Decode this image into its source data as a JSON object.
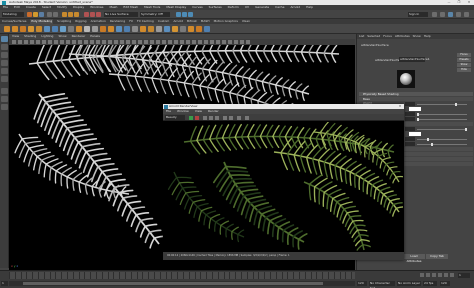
{
  "window": {
    "title": "Autodesk Maya 2018 - Student Version: untitled_scene*",
    "controls": [
      "—",
      "❐",
      "✕"
    ]
  },
  "menubar": [
    "File",
    "Edit",
    "Create",
    "Select",
    "Modify",
    "Display",
    "Windows",
    "Mesh",
    "Edit Mesh",
    "Mesh Tools",
    "Mesh Display",
    "Curves",
    "Surfaces",
    "Deform",
    "UV",
    "Generate",
    "Cache",
    "Arnold",
    "Help"
  ],
  "status": {
    "mode": "Modeling",
    "no_live_surface": "No Live Surface",
    "symmetry": "Symmetry: Off",
    "sign_in": "Sign In"
  },
  "shelf_tabs": [
    "Curves/Surfaces",
    "Poly Modeling",
    "Sculpting",
    "Rigging",
    "Animation",
    "Rendering",
    "FX",
    "FX Caching",
    "Custom",
    "Arnold",
    "Bifrost",
    "MASH",
    "Motion Graphics",
    "XGen"
  ],
  "shelf_active_tab": "Poly Modeling",
  "viewport": {
    "menu": [
      "View",
      "Shading",
      "Lighting",
      "Show",
      "Renderer",
      "Panels"
    ],
    "camera_label": "persp",
    "axis_labels": [
      "x",
      "y",
      "z"
    ]
  },
  "attribute_editor": {
    "tabs": [
      "List",
      "Selected",
      "Focus",
      "Attributes",
      "Show",
      "Help"
    ],
    "node_name": "aiStandardSurface",
    "type_label": "aiStandardSurface:",
    "field_value": "aiStandardSurface1",
    "buttons": [
      "Focus",
      "Presets",
      "Show",
      "Hide"
    ],
    "sample_label": "Material Sample",
    "section_title": "Physically Based Shading",
    "sections": [
      {
        "title": "Base",
        "rows": [
          {
            "label": "Weight",
            "value": 0.8
          },
          {
            "label": "Color"
          },
          {
            "label": "Diffuse Roughness",
            "value": 0.0
          },
          {
            "label": "Metalness",
            "value": 0.0
          }
        ]
      },
      {
        "title": "Specular",
        "rows": [
          {
            "label": "Weight",
            "value": 1.0
          },
          {
            "label": "Color"
          },
          {
            "label": "Roughness",
            "value": 0.2
          },
          {
            "label": "IOR",
            "value": 0.3
          }
        ]
      },
      {
        "title": "Transmission",
        "rows": []
      },
      {
        "title": "Subsurface",
        "rows": []
      },
      {
        "title": "Coat",
        "rows": []
      },
      {
        "title": "Sheen",
        "rows": []
      }
    ],
    "footer": [
      "Load Attributes",
      "Copy Tab"
    ]
  },
  "render_view": {
    "title": "Arnold RenderView",
    "menu": [
      "File",
      "Window",
      "View",
      "Render"
    ],
    "camera": "Beauty",
    "status": "00:00:12 | 2060x1146 | Cached Tiles | Memory: 1856 MB | Samples: 3/2/2/2/2/2 | persp | Frame: 1"
  },
  "timeline": {
    "start": "1",
    "end": "120",
    "range_start": "1",
    "range_end": "120",
    "current": "1",
    "fps": "24 fps",
    "character_set": "No Character Set",
    "anim_layer": "No Anim Layer"
  },
  "colors": {
    "accent": "#5a85a8",
    "maya_logo": "#28a0c8",
    "leaf_dark": "#22391a",
    "leaf_mid": "#4e6d2d",
    "leaf_light": "#9cb25a",
    "viewport_leaf": "#d6d6d6"
  }
}
